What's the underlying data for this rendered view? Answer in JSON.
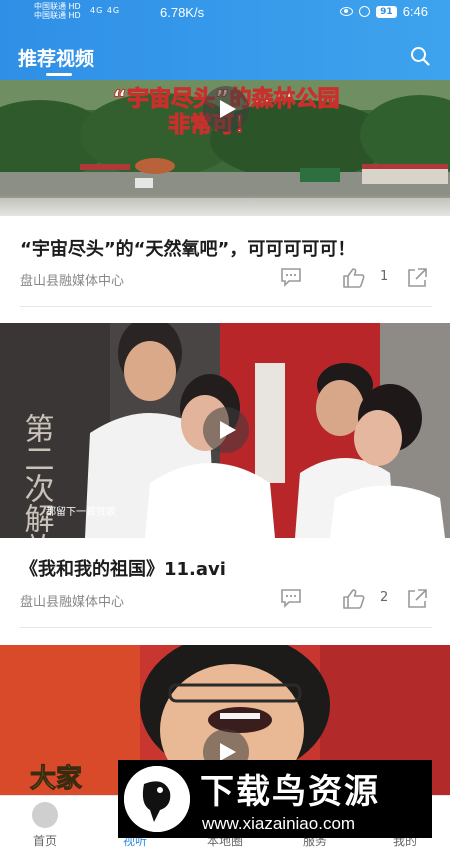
{
  "status_bar": {
    "carrier_1": "中国联通 HD",
    "carrier_2": "中国联通 HD",
    "signal": "4G 4G",
    "net_speed": "6.78K/s",
    "battery": "91",
    "time": "6:46"
  },
  "header": {
    "title": "推荐视频"
  },
  "feed": [
    {
      "thumbnail_caption_line1": "“宇宙尽头”的森林公园",
      "thumbnail_caption_line2": "非常可！",
      "title": "“宇宙尽头”的“天然氧吧”，可可可可可！",
      "source": "盘山县融媒体中心",
      "likes": "1"
    },
    {
      "thumbnail_caption_line1": "第二次解放",
      "thumbnail_caption_line2": "都留下一首赞歌",
      "title": "《我和我的祖国》11.avi",
      "source": "盘山县融媒体中心",
      "likes": "2"
    },
    {
      "thumbnail_caption_line1": "大家"
    }
  ],
  "tabbar": {
    "items": [
      {
        "label": "首页"
      },
      {
        "label": "视听"
      },
      {
        "label": "本地圈"
      },
      {
        "label": "服务"
      },
      {
        "label": "我的"
      }
    ],
    "active_index": 1
  },
  "watermark": {
    "brand": "下载鸟资源",
    "url": "www.xiazainiao.com"
  },
  "colors": {
    "accent": "#2f8fe6",
    "title_text": "#1c1c1c",
    "muted_text": "#888888"
  }
}
